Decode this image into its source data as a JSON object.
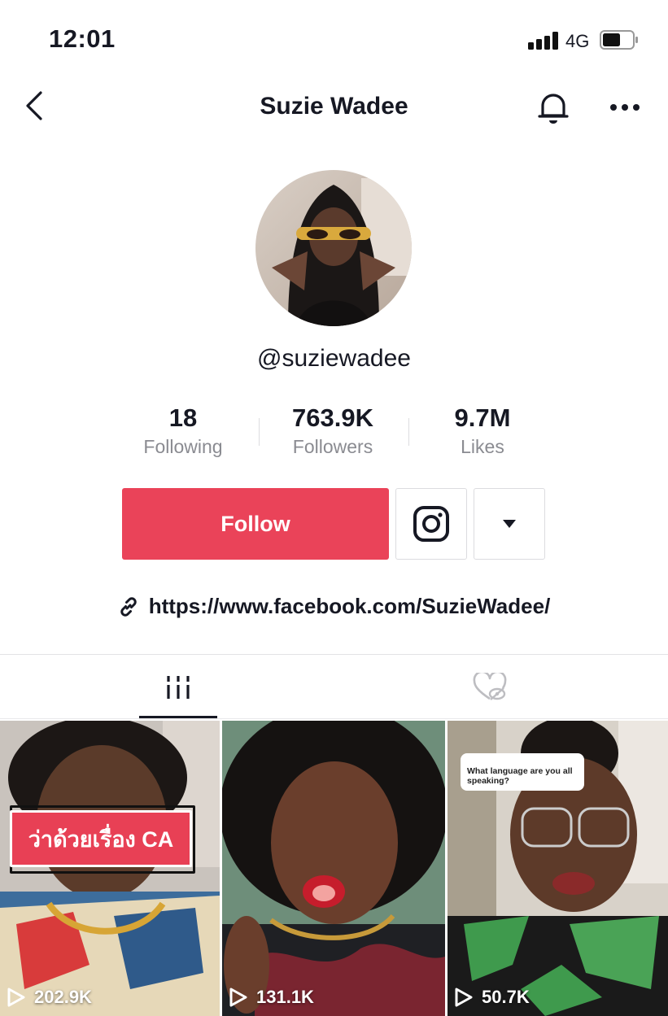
{
  "status_bar": {
    "time": "12:01",
    "network": "4G"
  },
  "header": {
    "title": "Suzie Wadee"
  },
  "profile": {
    "username": "@suziewadee"
  },
  "stats": [
    {
      "value": "18",
      "label": "Following"
    },
    {
      "value": "763.9K",
      "label": "Followers"
    },
    {
      "value": "9.7M",
      "label": "Likes"
    }
  ],
  "actions": {
    "follow_label": "Follow"
  },
  "bio": {
    "link": "https://www.facebook.com/SuzieWadee/"
  },
  "videos": [
    {
      "views": "202.9K",
      "caption": "ว่าด้วยเรื่อง CA"
    },
    {
      "views": "131.1K"
    },
    {
      "views": "50.7K",
      "bubble_text": "What language are you all speaking?"
    }
  ],
  "colors": {
    "accent": "#ea4359",
    "text": "#161823",
    "muted": "#8a8b91"
  },
  "icons": [
    "back-arrow-icon",
    "bell-icon",
    "more-dots-icon",
    "instagram-icon",
    "caret-down-icon",
    "link-icon",
    "grid-icon",
    "liked-hidden-icon",
    "play-icon"
  ]
}
